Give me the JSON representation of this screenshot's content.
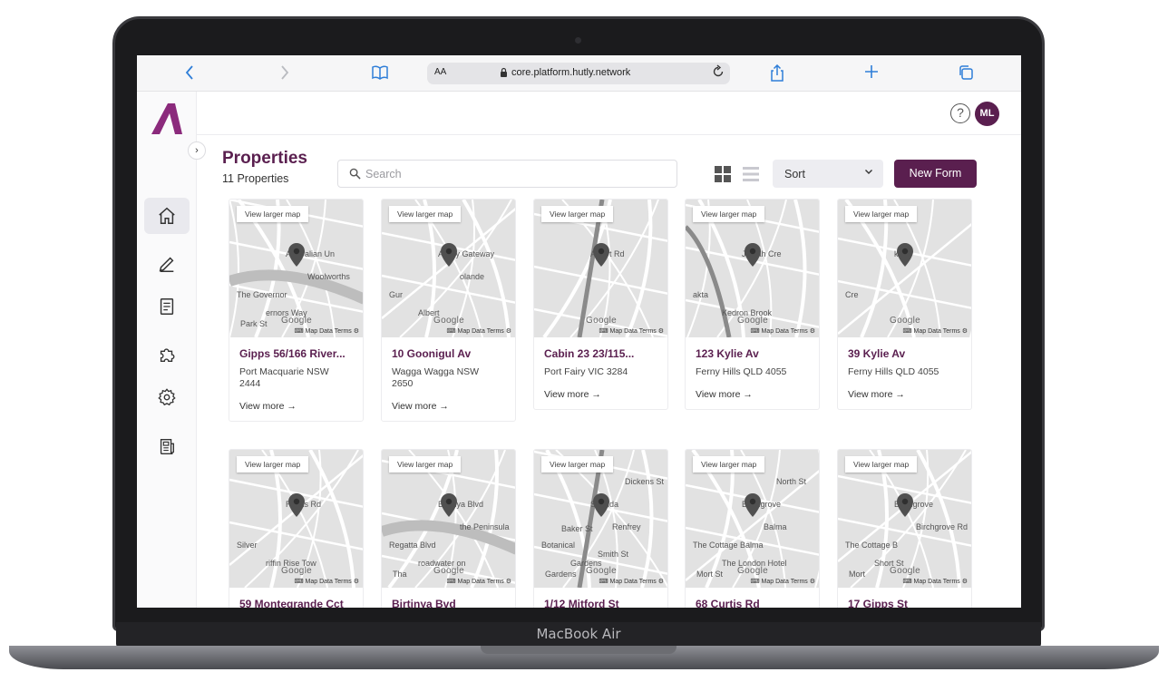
{
  "device": {
    "model_label": "MacBook Air"
  },
  "browser": {
    "aa_label": "AA",
    "url": "core.platform.hutly.network",
    "back_icon": "chevron-left-icon",
    "forward_icon": "chevron-right-icon",
    "bookmarks_icon": "book-icon",
    "share_icon": "share-icon",
    "new_tab_icon": "plus-icon",
    "tabs_icon": "tabs-icon",
    "accent": "#2f7ed8"
  },
  "header": {
    "help_icon": "question-icon",
    "help_glyph": "?",
    "avatar_initials": "ML"
  },
  "sidebar": {
    "expand_glyph": "›",
    "items": [
      {
        "name": "home",
        "icon": "home-icon",
        "active": true
      },
      {
        "name": "edit",
        "icon": "pen-icon"
      },
      {
        "name": "documents",
        "icon": "document-icon"
      },
      {
        "name": "integrations",
        "icon": "puzzle-icon"
      },
      {
        "name": "settings",
        "icon": "gear-icon"
      },
      {
        "name": "news",
        "icon": "newspaper-icon"
      }
    ]
  },
  "page": {
    "title": "Properties",
    "count": "11 Properties",
    "search_placeholder": "Search",
    "sort_label": "Sort",
    "new_form_label": "New Form",
    "brand_color": "#5a1f4f"
  },
  "cards": [
    {
      "title": "Gipps 56/166 River...",
      "address": "Port Macquarie NSW 2444",
      "more": "View more →",
      "map_label": "View larger map",
      "map_attrib": "⌨ Map Data  Terms  ⚙",
      "map_brand": "Google",
      "map_labels": [
        "Australian Un",
        "The Governor",
        "ernors Way",
        "Woolworths",
        "Park St"
      ]
    },
    {
      "title": "10 Goonigul Av",
      "address": "Wagga Wagga NSW 2650",
      "more": "View more →",
      "map_label": "View larger map",
      "map_attrib": "⌨ Map Data  Terms  ⚙",
      "map_brand": "Google",
      "map_labels": [
        "Ability Gateway",
        "Gur",
        "Albert",
        "olande"
      ]
    },
    {
      "title": "Cabin 23 23/115...",
      "address": "Port Fairy VIC 3284",
      "more": "View more →",
      "map_label": "View larger map",
      "map_attrib": "⌨ Map Data  Terms  ⚙",
      "map_brand": "Google",
      "map_labels": [
        "Albert Rd"
      ]
    },
    {
      "title": "123 Kylie Av",
      "address": "Ferny Hills QLD 4055",
      "more": "View more →",
      "map_label": "View larger map",
      "map_attrib": "⌨ Map Data  Terms  ⚙",
      "map_brand": "Google",
      "map_labels": [
        "Joalah Cre",
        "akta",
        "Kedron Brook"
      ]
    },
    {
      "title": "39 Kylie Av",
      "address": "Ferny Hills QLD 4055",
      "more": "View more →",
      "map_label": "View larger map",
      "map_attrib": "⌨ Map Data  Terms  ⚙",
      "map_brand": "Google",
      "map_labels": [
        "kta",
        "Cre"
      ]
    },
    {
      "title": "59 Montegrande Cct",
      "address": "",
      "more": "",
      "map_label": "View larger map",
      "map_attrib": "⌨ Map Data  Terms  ⚙",
      "map_brand": "Google",
      "map_labels": [
        "Rocks Rd",
        "Silver",
        "riffin Rise Tow"
      ]
    },
    {
      "title": "Birtinya Bvd",
      "address": "",
      "more": "",
      "map_label": "View larger map",
      "map_attrib": "⌨ Map Data  Terms  ⚙",
      "map_brand": "Google",
      "map_labels": [
        "Birtinya Blvd",
        "Regatta Blvd",
        "roadwater on",
        "the Peninsula",
        "Tha"
      ]
    },
    {
      "title": "1/12 Mitford St",
      "address": "",
      "more": "",
      "map_label": "View larger map",
      "map_attrib": "⌨ Map Data  Terms  ⚙",
      "map_brand": "Google",
      "map_labels": [
        "St Kilda",
        "Botanical",
        "Gardens",
        "Renfrey",
        "Gardens",
        "Dickens St",
        "Baker St",
        "Smith St"
      ]
    },
    {
      "title": "68 Curtis Rd",
      "address": "",
      "more": "",
      "map_label": "View larger map",
      "map_attrib": "⌨ Map Data  Terms  ⚙",
      "map_brand": "Google",
      "map_labels": [
        "Birchgrove",
        "The Cottage Balma",
        "The London Hotel",
        "Balma",
        "Mort St",
        "North St"
      ]
    },
    {
      "title": "17 Gipps St",
      "address": "",
      "more": "",
      "map_label": "View larger map",
      "map_attrib": "⌨ Map Data  Terms  ⚙",
      "map_brand": "Google",
      "map_labels": [
        "Birchgrove",
        "The Cottage B",
        "Short St",
        "Birchgrove Rd",
        "Mort"
      ]
    }
  ]
}
